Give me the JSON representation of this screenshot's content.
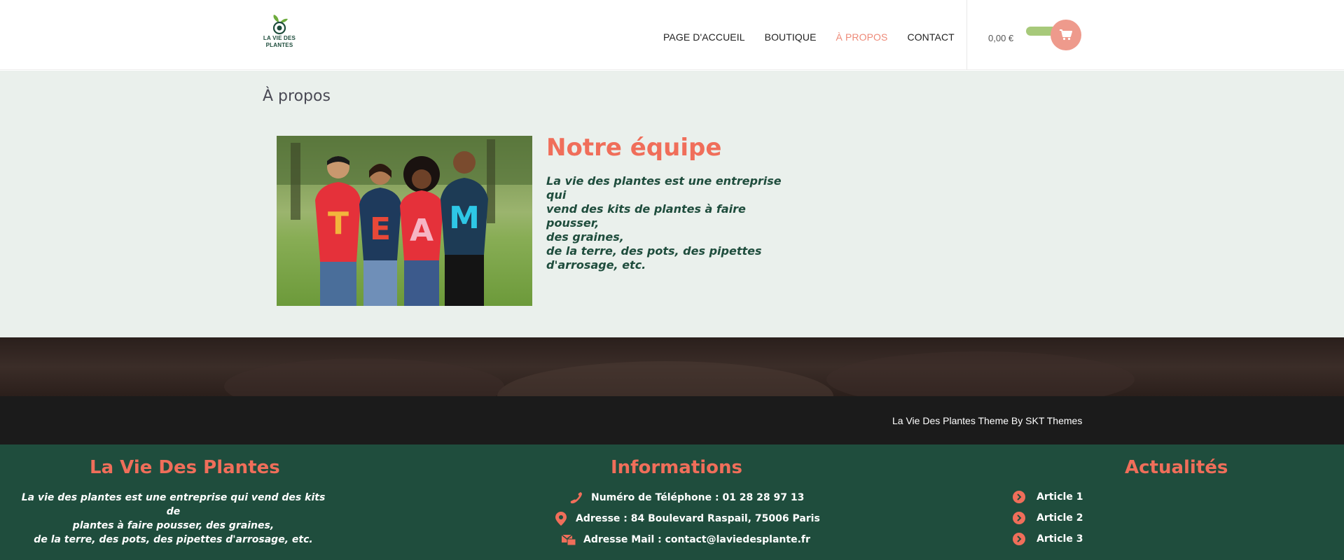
{
  "header": {
    "logo_line1": "LA VIE DES",
    "logo_line2": "PLANTES",
    "nav": [
      {
        "label": "PAGE D'ACCUEIL"
      },
      {
        "label": "BOUTIQUE"
      },
      {
        "label": "À PROPOS"
      },
      {
        "label": "CONTACT"
      }
    ],
    "cart_total": "0,00 €"
  },
  "about": {
    "page_title": "À propos",
    "team_title": "Notre équipe",
    "team_desc_lines": [
      "La vie des plantes est une entreprise qui",
      "vend des kits de plantes à faire pousser,",
      "des graines,",
      "de la terre, des pots, des pipettes",
      "d'arrosage, etc."
    ],
    "photo_shirt_letters": [
      "T",
      "E",
      "A",
      "M"
    ]
  },
  "copyright": "La Vie Des Plantes Theme By SKT Themes",
  "footer": {
    "col1": {
      "heading": "La Vie Des Plantes",
      "text_lines": [
        "La vie des plantes est une entreprise qui vend des kits de",
        "plantes à faire pousser, des graines,",
        "de la terre, des pots, des pipettes d'arrosage, etc."
      ]
    },
    "col2": {
      "heading": "Informations",
      "phone": "Numéro de Téléphone : 01 28 28 97 13",
      "address": "Adresse : 84 Boulevard Raspail, 75006 Paris",
      "email": "Adresse Mail : contact@laviedesplante.fr"
    },
    "col3": {
      "heading": "Actualités",
      "articles": [
        "Article 1",
        "Article 2",
        "Article 3"
      ]
    }
  },
  "colors": {
    "accent": "#f06e5a",
    "footer_bg": "#1f4d3d",
    "about_bg": "#eaf0ec",
    "cart_btn": "#ee9a8c"
  }
}
